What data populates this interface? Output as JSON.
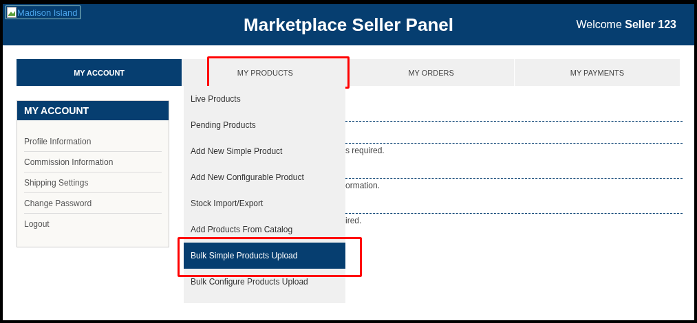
{
  "header": {
    "logo_alt": "Madison Island",
    "title": "Marketplace Seller Panel",
    "welcome": "Welcome **Seller 123**"
  },
  "tabs": [
    {
      "label": "MY ACCOUNT",
      "selected": true,
      "highlighted": false
    },
    {
      "label": "MY PRODUCTS",
      "selected": false,
      "highlighted": true
    },
    {
      "label": "MY ORDERS",
      "selected": false,
      "highlighted": false
    },
    {
      "label": "MY PAYMENTS",
      "selected": false,
      "highlighted": false
    }
  ],
  "sidebar": {
    "title": "MY ACCOUNT",
    "items": [
      "Profile Information",
      "Commission Information",
      "Shipping Settings",
      "Change Password",
      "Logout"
    ]
  },
  "dropdown": {
    "items": [
      {
        "label": "Live Products",
        "selected": false,
        "highlighted": false
      },
      {
        "label": "Pending Products",
        "selected": false,
        "highlighted": false
      },
      {
        "label": "Add New Simple Product",
        "selected": false,
        "highlighted": false
      },
      {
        "label": "Add New Configurable Product",
        "selected": false,
        "highlighted": false
      },
      {
        "label": "Stock Import/Export",
        "selected": false,
        "highlighted": false
      },
      {
        "label": "Add Products From Catalog",
        "selected": false,
        "highlighted": false
      },
      {
        "label": "Bulk Simple Products Upload",
        "selected": true,
        "highlighted": true
      },
      {
        "label": "Bulk Configure Products Upload",
        "selected": false,
        "highlighted": false
      }
    ]
  },
  "content_rows": [
    "s required.",
    "ormation.",
    "ired."
  ]
}
